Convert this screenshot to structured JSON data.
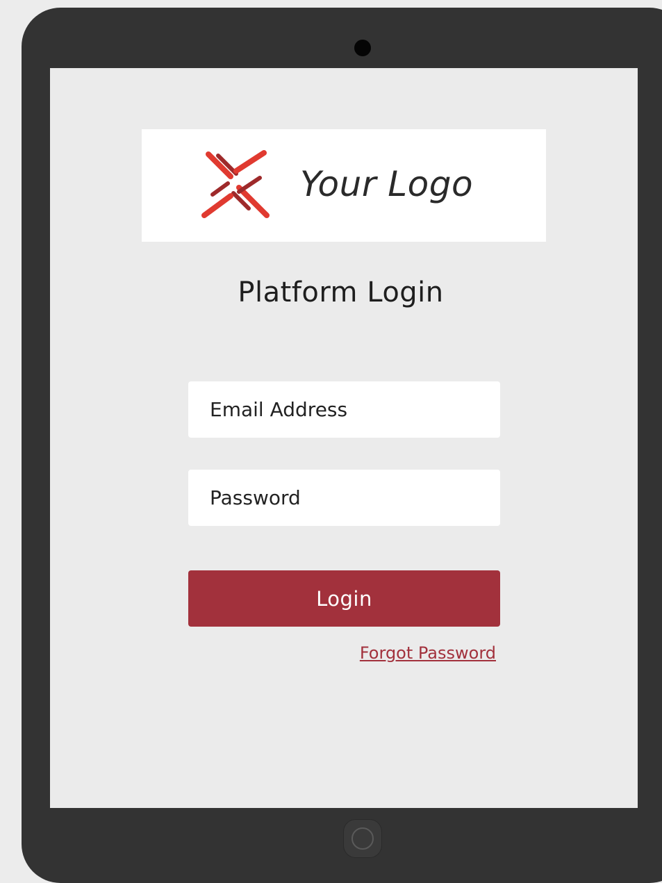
{
  "logo": {
    "text": "Your Logo",
    "mark_color": "#e03a30",
    "mark_dark_color": "#9e2a2b"
  },
  "form": {
    "title": "Platform Login",
    "email_placeholder": "Email Address",
    "password_placeholder": "Password",
    "login_label": "Login",
    "forgot_label": "Forgot Password"
  },
  "colors": {
    "device_frame": "#333333",
    "screen_background": "#ebebeb",
    "accent": "#a2313c"
  }
}
